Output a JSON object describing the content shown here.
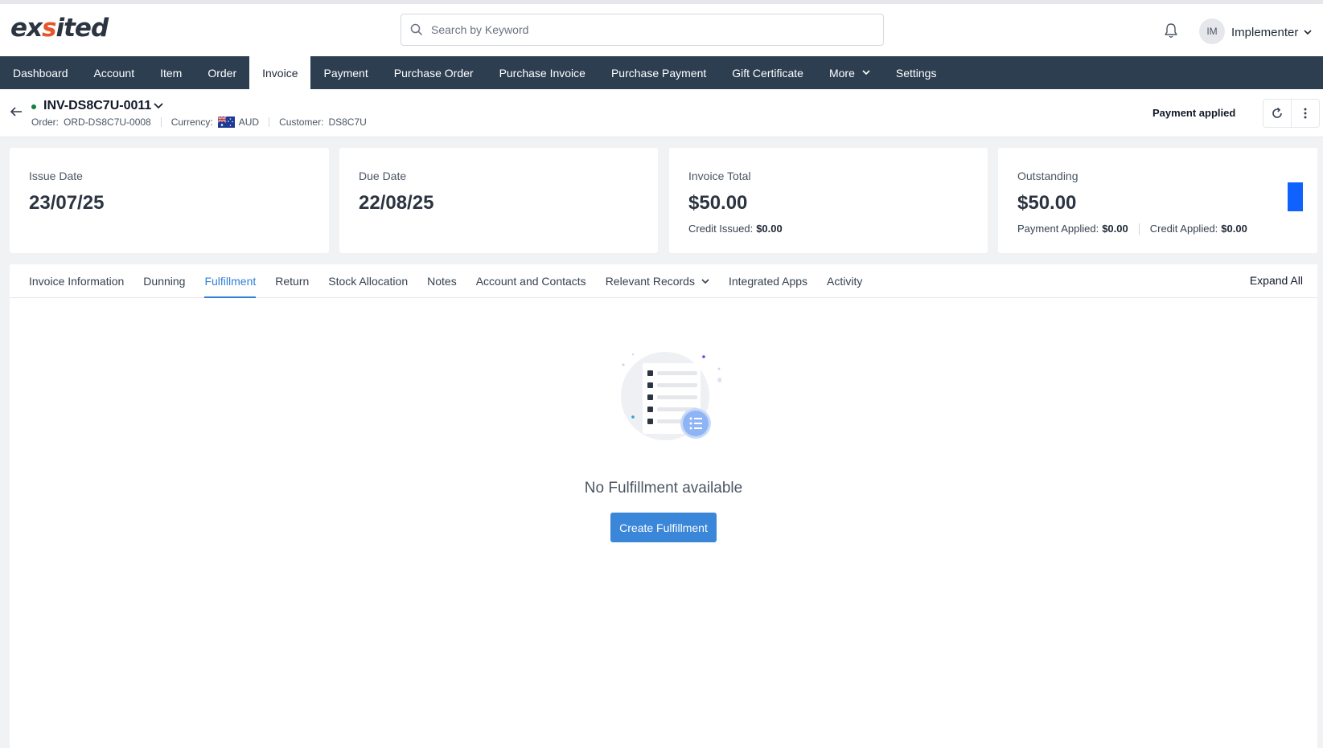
{
  "app": {
    "logo_text_1": "ex",
    "logo_text_2": "s",
    "logo_text_3": "ited",
    "brand_color": "#2d3e50",
    "accent_color": "#e8542a"
  },
  "search": {
    "placeholder": "Search by Keyword",
    "icon": "search-icon"
  },
  "user": {
    "initials": "IM",
    "name": "Implementer"
  },
  "nav": {
    "items": [
      {
        "label": "Dashboard"
      },
      {
        "label": "Account"
      },
      {
        "label": "Item"
      },
      {
        "label": "Order"
      },
      {
        "label": "Invoice",
        "active": true
      },
      {
        "label": "Payment"
      },
      {
        "label": "Purchase Order"
      },
      {
        "label": "Purchase Invoice"
      },
      {
        "label": "Purchase Payment"
      },
      {
        "label": "Gift Certificate"
      },
      {
        "label": "More"
      },
      {
        "label": "Settings"
      }
    ]
  },
  "header": {
    "title": "INV-DS8C7U-0011",
    "order_label": "Order:",
    "order_value": "ORD-DS8C7U-0008",
    "currency_label": "Currency:",
    "currency_value": "AUD",
    "customer_label": "Customer:",
    "customer_value": "DS8C7U",
    "status": "Payment applied"
  },
  "cards": {
    "issue": {
      "label": "Issue Date",
      "value": "23/07/25"
    },
    "due": {
      "label": "Due Date",
      "value": "22/08/25"
    },
    "total": {
      "label": "Invoice Total",
      "value": "$50.00",
      "credit_issued_label": "Credit Issued:",
      "credit_issued_value": "$0.00"
    },
    "outstanding": {
      "label": "Outstanding",
      "value": "$50.00",
      "payment_applied_label": "Payment Applied:",
      "payment_applied_value": "$0.00",
      "credit_applied_label": "Credit Applied:",
      "credit_applied_value": "$0.00"
    }
  },
  "tabs": {
    "items": [
      {
        "label": "Invoice Information"
      },
      {
        "label": "Dunning"
      },
      {
        "label": "Fulfillment",
        "active": true
      },
      {
        "label": "Return"
      },
      {
        "label": "Stock Allocation"
      },
      {
        "label": "Notes"
      },
      {
        "label": "Account and Contacts"
      },
      {
        "label": "Relevant Records"
      },
      {
        "label": "Integrated Apps"
      },
      {
        "label": "Activity"
      }
    ],
    "expand_all": "Expand All"
  },
  "empty_state": {
    "message": "No Fulfillment available",
    "button": "Create Fulfillment"
  }
}
